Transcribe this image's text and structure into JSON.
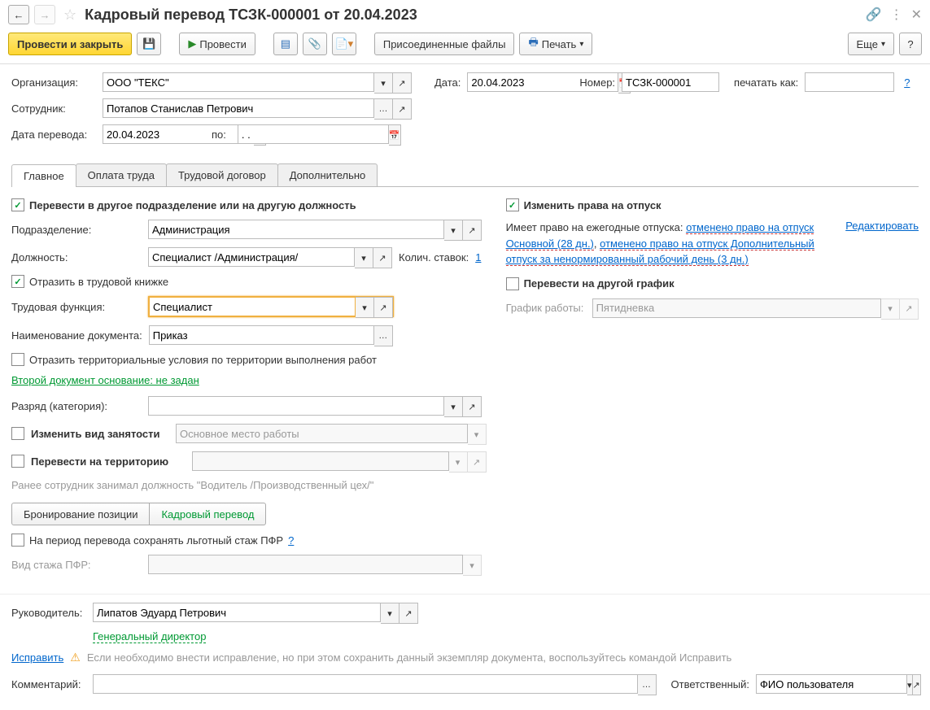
{
  "title": "Кадровый перевод ТСЗК-000001 от 20.04.2023",
  "toolbar": {
    "post_close": "Провести и закрыть",
    "post": "Провести",
    "attached": "Присоединенные файлы",
    "print": "Печать",
    "more": "Еще"
  },
  "header": {
    "org_label": "Организация:",
    "org_value": "ООО \"ТЕКС\"",
    "date_label": "Дата:",
    "date_value": "20.04.2023",
    "number_label": "Номер:",
    "number_value": "ТСЗК-000001",
    "print_as_label": "печатать как:",
    "employee_label": "Сотрудник:",
    "employee_value": "Потапов Станислав Петрович",
    "transfer_date_label": "Дата перевода:",
    "transfer_date_value": "20.04.2023",
    "to_label": "по:",
    "to_value": ". ."
  },
  "tabs": {
    "main": "Главное",
    "pay": "Оплата труда",
    "contract": "Трудовой договор",
    "extra": "Дополнительно"
  },
  "main": {
    "transfer_check": "Перевести в другое подразделение или на другую должность",
    "dept_label": "Подразделение:",
    "dept_value": "Администрация",
    "position_label": "Должность:",
    "position_value": "Специалист /Администрация/",
    "rates_label": "Колич. ставок:",
    "rates_value": "1",
    "labor_book": "Отразить в трудовой книжке",
    "func_label": "Трудовая функция:",
    "func_value": "Специалист",
    "doc_name_label": "Наименование документа:",
    "doc_name_value": "Приказ",
    "territory_cond": "Отразить территориальные условия по территории выполнения работ",
    "second_doc": "Второй документ основание: не задан",
    "rank_label": "Разряд (категория):",
    "employment_check": "Изменить вид занятости",
    "employment_value": "Основное место работы",
    "territory_check": "Перевести на территорию",
    "previous": "Ранее сотрудник занимал должность \"Водитель /Производственный цех/\"",
    "seg_booking": "Бронирование позиции",
    "seg_transfer": "Кадровый перевод",
    "pfr_check": "На период перевода сохранять льготный стаж ПФР",
    "pfr_type_label": "Вид стажа ПФР:"
  },
  "vacation": {
    "change_check": "Изменить права на отпуск",
    "text1": "Имеет право на ежегодные отпуска: ",
    "link1": "отменено право на отпуск Основной (28 дн.)",
    "sep": ", ",
    "link2": "отменено право на отпуск Дополнительный отпуск за ненормированный рабочий день (3 дн.)",
    "edit": "Редактировать",
    "schedule_check": "Перевести на другой график",
    "schedule_label": "График работы:",
    "schedule_value": "Пятидневка"
  },
  "footer": {
    "manager_label": "Руководитель:",
    "manager_value": "Липатов Эдуард Петрович",
    "manager_position": "Генеральный директор",
    "fix_link": "Исправить",
    "fix_text": "Если необходимо внести исправление, но при этом сохранить данный экземпляр документа, воспользуйтесь командой Исправить",
    "comment_label": "Комментарий:",
    "responsible_label": "Ответственный:",
    "responsible_value": "ФИО пользователя"
  }
}
